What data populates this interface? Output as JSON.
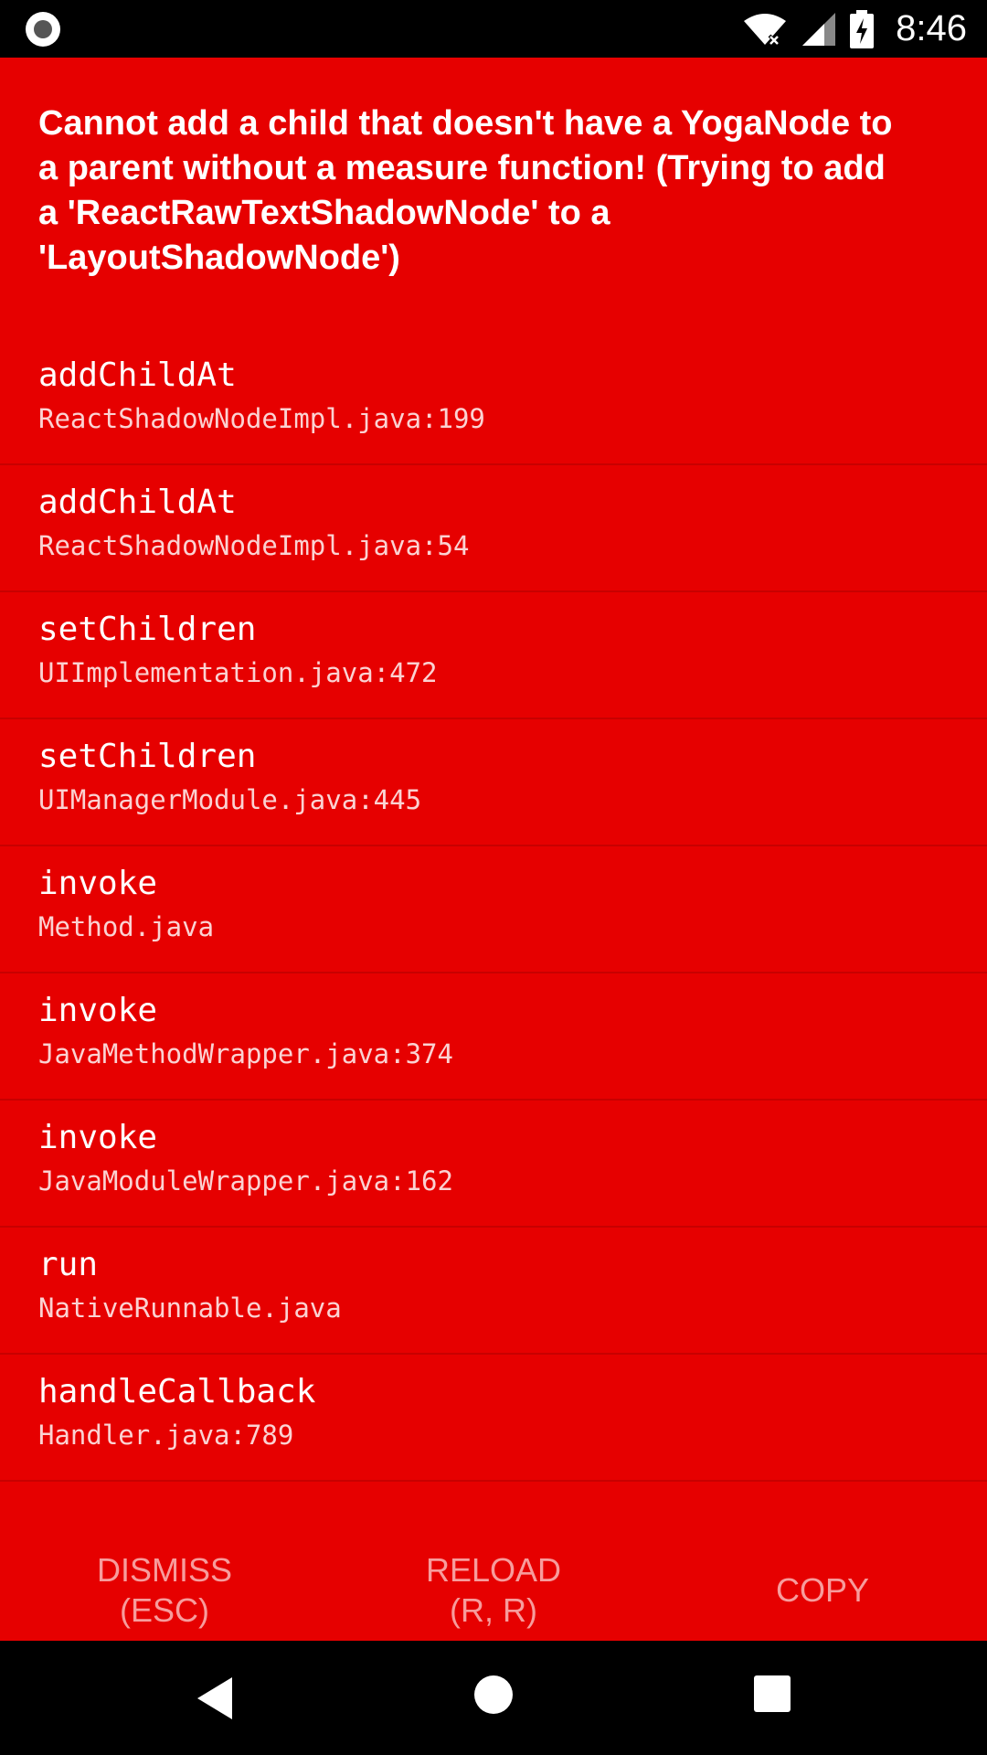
{
  "status_bar": {
    "time": "8:46",
    "icons": [
      "record-icon",
      "wifi-off-icon",
      "cell-signal-icon",
      "battery-charging-icon"
    ]
  },
  "error": {
    "message": "Cannot add a child that doesn't have a YogaNode to a parent without a measure function! (Trying to add a 'ReactRawTextShadowNode' to a 'LayoutShadowNode')"
  },
  "stack": [
    {
      "method": "addChildAt",
      "file": "ReactShadowNodeImpl.java:199"
    },
    {
      "method": "addChildAt",
      "file": "ReactShadowNodeImpl.java:54"
    },
    {
      "method": "setChildren",
      "file": "UIImplementation.java:472"
    },
    {
      "method": "setChildren",
      "file": "UIManagerModule.java:445"
    },
    {
      "method": "invoke",
      "file": "Method.java"
    },
    {
      "method": "invoke",
      "file": "JavaMethodWrapper.java:374"
    },
    {
      "method": "invoke",
      "file": "JavaModuleWrapper.java:162"
    },
    {
      "method": "run",
      "file": "NativeRunnable.java"
    },
    {
      "method": "handleCallback",
      "file": "Handler.java:789"
    }
  ],
  "buttons": {
    "dismiss": "DISMISS\n(ESC)",
    "reload": "RELOAD\n(R, R)",
    "copy": "COPY"
  },
  "colors": {
    "background": "#e60000",
    "button_text": "#f79c9c"
  },
  "nav_bar": {
    "icons": [
      "back-icon",
      "home-icon",
      "recents-icon"
    ]
  }
}
